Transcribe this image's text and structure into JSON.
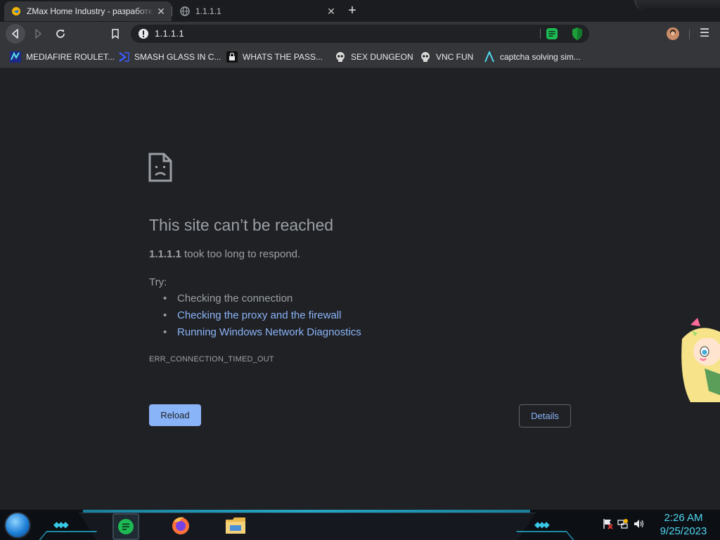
{
  "tabs": [
    {
      "title": "ZMax Home Industry - разработк...",
      "favicon": "zmax-favicon-icon",
      "active": true
    },
    {
      "title": "1.1.1.1",
      "favicon": "globe-icon",
      "active": false
    }
  ],
  "toolbar": {
    "url": "1.1.1.1",
    "icons": [
      "back-icon",
      "forward-icon",
      "reload-icon",
      "bookmark-icon",
      "info-icon",
      "extension-notes-icon",
      "extension-shield-icon",
      "profile-avatar",
      "menu-icon"
    ]
  },
  "bookmarks": [
    {
      "label": "MEDIAFIRE ROULET...",
      "icon": "mediafire-icon"
    },
    {
      "label": "SMASH GLASS IN C...",
      "icon": "chevron-logo-icon"
    },
    {
      "label": "WHATS THE PASS...",
      "icon": "lock-box-icon"
    },
    {
      "label": "SEX DUNGEON",
      "icon": "skull-icon"
    },
    {
      "label": "VNC FUN",
      "icon": "skull-icon"
    },
    {
      "label": "captcha solving sim...",
      "icon": "a-logo-icon"
    }
  ],
  "error": {
    "title": "This site can’t be reached",
    "host": "1.1.1.1",
    "summary_rest": " took too long to respond.",
    "try_label": "Try:",
    "suggestions": [
      "Checking the connection",
      "Checking the proxy and the firewall",
      "Running Windows Network Diagnostics"
    ],
    "code": "ERR_CONNECTION_TIMED_OUT",
    "reload_label": "Reload",
    "details_label": "Details"
  },
  "taskbar": {
    "apps": [
      "start-orb",
      "notes-app-icon",
      "firefox-icon",
      "file-explorer-icon"
    ],
    "tray": [
      "flag-icon",
      "network-icon",
      "volume-icon"
    ],
    "time": "2:26 AM",
    "date": "9/25/2023"
  },
  "colors": {
    "page_bg": "#202124",
    "toolbar_bg": "#35363a",
    "link": "#8ab4f8",
    "text_muted": "#9aa0a6",
    "clock": "#4fd8f0"
  }
}
